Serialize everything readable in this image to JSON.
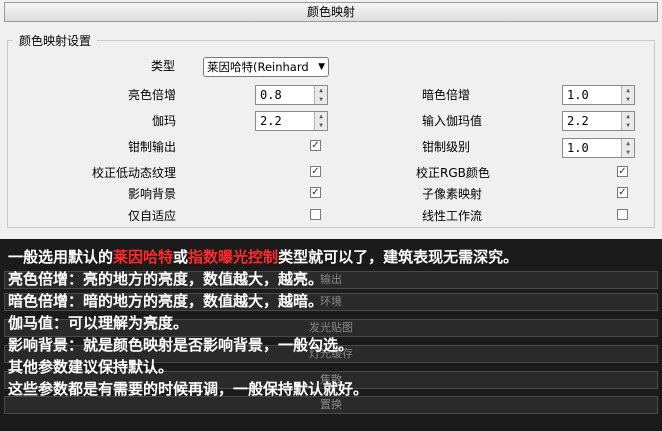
{
  "window": {
    "title": "颜色映射"
  },
  "group": {
    "title": "颜色映射设置"
  },
  "type": {
    "label": "类型",
    "value": "莱因哈特(Reinhard"
  },
  "left": {
    "bright_mult": {
      "label": "亮色倍增",
      "value": "0.8"
    },
    "gamma": {
      "label": "伽玛",
      "value": "2.2"
    },
    "clamp_output": {
      "label": "钳制输出",
      "checked": true
    },
    "correct_ldr_textures": {
      "label": "校正低动态纹理",
      "checked": true
    },
    "affect_background": {
      "label": "影响背景",
      "checked": true
    },
    "adaptation_only": {
      "label": "仅自适应",
      "checked": false
    }
  },
  "right": {
    "dark_mult": {
      "label": "暗色倍增",
      "value": "1.0"
    },
    "input_gamma": {
      "label": "输入伽玛值",
      "value": "2.2"
    },
    "clamp_level": {
      "label": "钳制级别",
      "value": "1.0"
    },
    "correct_rgb_colors": {
      "label": "校正RGB颜色",
      "checked": true
    },
    "subpixel_mapping": {
      "label": "子像素映射",
      "checked": true
    },
    "linear_workflow": {
      "label": "线性工作流",
      "checked": false
    }
  },
  "background_panels": [
    "输出",
    "环境",
    "发光贴图",
    "灯光缓存",
    "焦散",
    "置换"
  ],
  "notes": {
    "line1": {
      "a": "一般选用默认的",
      "b": "莱因哈特",
      "c": "或",
      "d": "指数曝光控制",
      "e": "类型就可以了，建筑表现无需深究。"
    },
    "line2": "亮色倍增：亮的地方的亮度，数值越大，越亮。",
    "line3": "暗色倍增：暗的地方的亮度，数值越大，越暗。",
    "line4": "伽马值：可以理解为亮度。",
    "line5": "影响背景：就是颜色映射是否影响背景，一般勾选。",
    "line6": "其他参数建议保持默认。",
    "line7": "这些参数都是有需要的时候再调，一般保持默认就好。"
  },
  "colors": {
    "accent_red": "#ff2a2a",
    "overlay_bg": "#1b1b1b"
  }
}
